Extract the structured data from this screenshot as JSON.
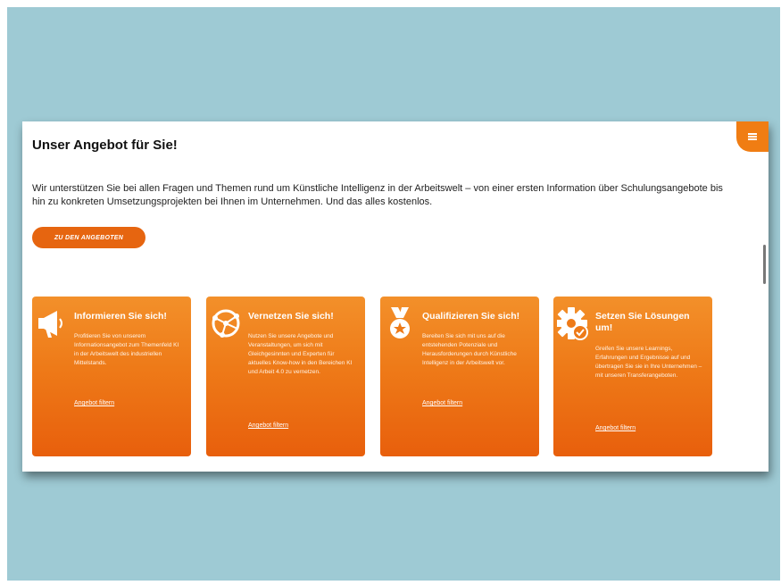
{
  "section": {
    "title": "Unser Angebot für Sie!",
    "intro": "Wir unterstützen Sie bei allen Fragen und Themen rund um Künstliche Intelligenz in der Arbeitswelt – von einer ersten Information über Schulungsangebote bis hin zu konkreten Umsetzungsprojekten bei Ihnen im Unternehmen. Und das alles kostenlos.",
    "cta_label": "Zu den Angeboten"
  },
  "cards": [
    {
      "icon": "megaphone-icon",
      "title": "Informieren Sie sich!",
      "description": "Profitieren Sie von unserem Informationsangebot zum Themenfeld KI in der Arbeitswelt des industriellen Mittelstands.",
      "link": "Angebot filtern"
    },
    {
      "icon": "network-globe-icon",
      "title": "Vernetzen Sie sich!",
      "description": "Nutzen Sie unsere Angebote und Veranstaltungen, um sich mit Gleichgesinnten und Experten für aktuelles Know-how in den Bereichen KI und Arbeit 4.0 zu vernetzen.",
      "link": "Angebot filtern"
    },
    {
      "icon": "medal-icon",
      "title": "Qualifizieren Sie sich!",
      "description": "Bereiten Sie sich mit uns auf die entstehenden Potenziale und Herausforderungen durch Künstliche Intelligenz in der Arbeitswelt vor.",
      "link": "Angebot filtern"
    },
    {
      "icon": "gear-check-icon",
      "title": "Setzen Sie Lösungen um!",
      "description": "Greifen Sie unsere Learnings, Erfahrungen und Ergebnisse auf und übertragen Sie sie in Ihre Unternehmen – mit unseren Transferangeboten.",
      "link": "Angebot filtern"
    }
  ],
  "colors": {
    "backdrop": "#9ecad4",
    "accent": "#f07d13",
    "button": "#e66510"
  }
}
